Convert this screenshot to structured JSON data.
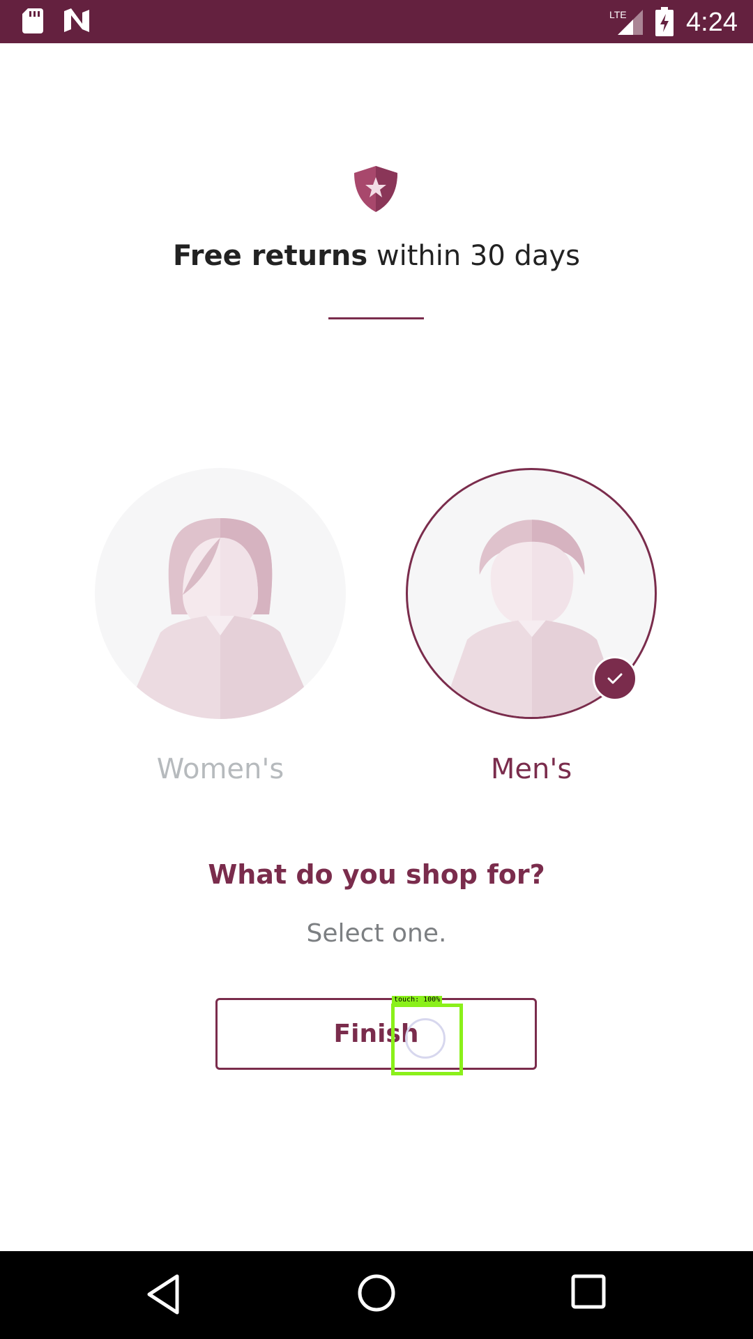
{
  "status_bar": {
    "time": "4:24",
    "network": "LTE",
    "icons": [
      "sd-card-icon",
      "n-icon",
      "lte-signal-icon",
      "battery-charging-icon"
    ]
  },
  "promo": {
    "icon": "shield-star-icon",
    "bold_text": "Free returns",
    "rest_text": " within 30 days"
  },
  "options": [
    {
      "label": "Women's",
      "selected": false,
      "icon": "woman-avatar-icon"
    },
    {
      "label": "Men's",
      "selected": true,
      "icon": "man-avatar-icon"
    }
  ],
  "question": {
    "title": "What do you shop for?",
    "hint": "Select one."
  },
  "finish_button": {
    "label": "Finish"
  },
  "touch_overlay": {
    "label": "touch: 100%"
  },
  "nav_bar": {
    "icons": [
      "back-icon",
      "home-icon",
      "recents-icon"
    ]
  },
  "colors": {
    "brand": "#7a2c4c",
    "status_bar": "#64213f",
    "unselected_label": "#b6babd"
  }
}
